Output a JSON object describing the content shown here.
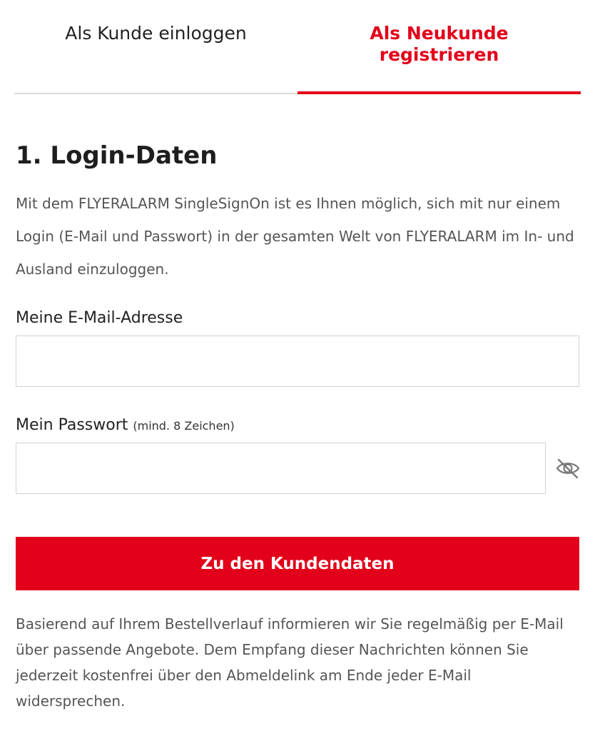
{
  "tabs": {
    "login_label": "Als Kunde einloggen",
    "register_label": "Als Neukunde registrieren"
  },
  "section": {
    "title": "1. Login-Daten",
    "intro": "Mit dem FLYERALARM SingleSignOn ist es Ihnen möglich, sich mit nur einem Login (E-Mail und Passwort) in der gesamten Welt von FLYERALARM im In- und Ausland einzuloggen."
  },
  "form": {
    "email_label": "Meine E-Mail-Adresse",
    "email_value": "",
    "password_label": "Mein Passwort",
    "password_hint": "(mind. 8 Zeichen)",
    "password_value": "",
    "toggle_icon": "eye-slash-icon",
    "submit_label": "Zu den Kundendaten"
  },
  "notice": "Basierend auf Ihrem Bestellverlauf informieren wir Sie regelmäßig per E-Mail über passende Angebote. Dem Empfang dieser Nachrichten können Sie jederzeit kostenfrei über den Abmeldelink am Ende jeder E-Mail widersprechen.",
  "colors": {
    "accent": "#e2001a",
    "text": "#222222",
    "muted_text": "#555555",
    "border": "#d2d2d2"
  }
}
